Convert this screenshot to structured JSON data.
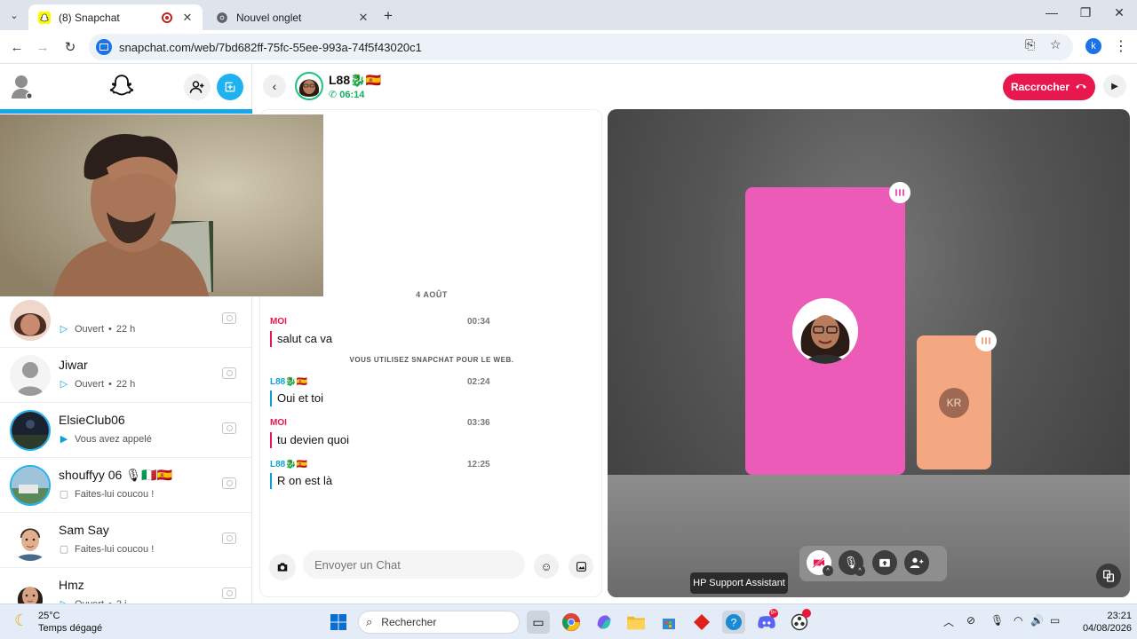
{
  "browser": {
    "tabs": [
      {
        "title": "(8) Snapchat",
        "active": true
      },
      {
        "title": "Nouvel onglet",
        "active": false
      }
    ],
    "new_tab": "+",
    "url": "snapchat.com/web/7bd682ff-75fc-55ee-993a-74f5f43020c1",
    "profile_initial": "k",
    "window_controls": {
      "minimize": "—",
      "maximize": "❐",
      "close": "✕"
    }
  },
  "chat_list": [
    {
      "name": "",
      "status": "Ouvert",
      "time": "22 h",
      "status_icon": "sent-arrow-icon"
    },
    {
      "name": "Jiwar",
      "status": "Ouvert",
      "time": "22 h",
      "status_icon": "sent-arrow-icon"
    },
    {
      "name": "ElsieClub06",
      "status": "Vous avez appelé",
      "time": "",
      "status_icon": "video-call-icon"
    },
    {
      "name": "shouffyy 06 🎙🇮🇹🇪🇸",
      "status": "Faites-lui coucou !",
      "time": "",
      "status_icon": "chat-bubble-icon"
    },
    {
      "name": "Sam Say",
      "status": "Faites-lui coucou !",
      "time": "",
      "status_icon": "chat-bubble-icon"
    },
    {
      "name": "Hmz",
      "status": "Ouvert",
      "time": "2 j",
      "status_icon": "sent-arrow-icon"
    }
  ],
  "chat_header": {
    "name": "L88🐉🇪🇸",
    "call_duration": "06:14",
    "hangup_label": "Raccrocher"
  },
  "chat": {
    "date_separator": "4 AOÛT",
    "system_message": "VOUS UTILISEZ SNAPCHAT POUR LE WEB.",
    "messages": [
      {
        "sender": "MOI",
        "time": "00:34",
        "text": "salut ca va"
      },
      {
        "sender": "L88🐉🇪🇸",
        "time": "02:24",
        "text": "Oui et toi"
      },
      {
        "sender": "MOI",
        "time": "03:36",
        "text": "tu devien quoi"
      },
      {
        "sender": "L88🐉🇪🇸",
        "time": "12:25",
        "text": "R on est là"
      }
    ],
    "composer_placeholder": "Envoyer un Chat"
  },
  "call": {
    "participant_initials": "KR",
    "tooltip": "HP Support Assistant"
  },
  "colors": {
    "snap_red": "#e8174e",
    "snap_blue": "#0d9fd6",
    "call_green": "#0fae5c",
    "tile_pink": "#ec5bb8",
    "tile_peach": "#f3a882"
  },
  "taskbar": {
    "weather_temp": "25°C",
    "weather_desc": "Temps dégagé",
    "search_label": "Rechercher",
    "discord_badge": "9+",
    "time": "23:21",
    "date": "04/08/2026"
  }
}
